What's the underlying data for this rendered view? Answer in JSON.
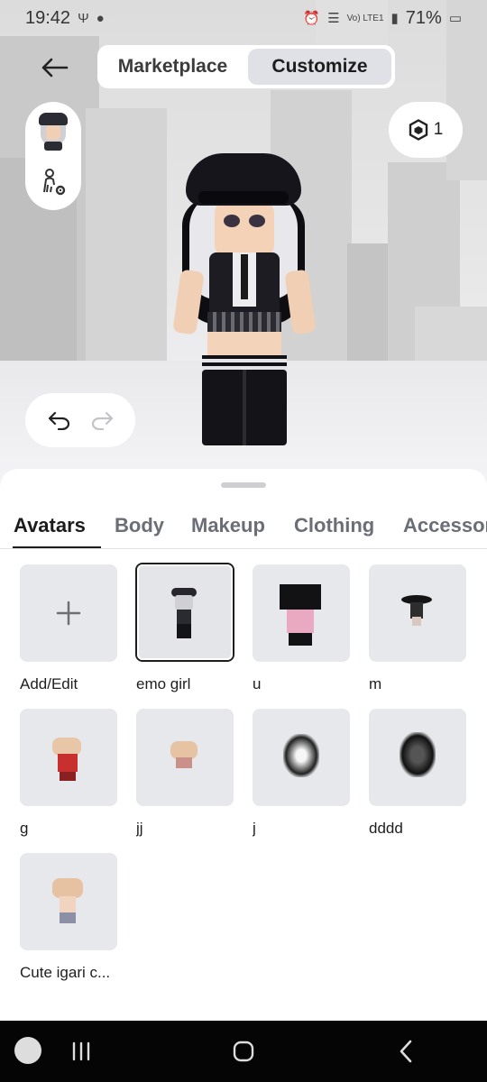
{
  "status_bar": {
    "time": "19:42",
    "battery": "71%",
    "network": "Vo) LTE1"
  },
  "header": {
    "tabs": [
      {
        "label": "Marketplace",
        "active": false
      },
      {
        "label": "Customize",
        "active": true
      }
    ]
  },
  "robux": {
    "count": "1"
  },
  "category_tabs": [
    {
      "label": "Avatars",
      "active": true
    },
    {
      "label": "Body",
      "active": false
    },
    {
      "label": "Makeup",
      "active": false
    },
    {
      "label": "Clothing",
      "active": false
    },
    {
      "label": "Accessories",
      "active": false
    }
  ],
  "avatars": [
    {
      "label": "Add/Edit",
      "type": "add"
    },
    {
      "label": "emo girl",
      "selected": true
    },
    {
      "label": "u"
    },
    {
      "label": "m"
    },
    {
      "label": "g"
    },
    {
      "label": "jj"
    },
    {
      "label": "j"
    },
    {
      "label": "dddd"
    },
    {
      "label": "Cute igari c..."
    }
  ],
  "colors": {
    "accent": "#1c1c1c",
    "tile_bg": "#e7e8eb",
    "navbar": "#050505"
  }
}
